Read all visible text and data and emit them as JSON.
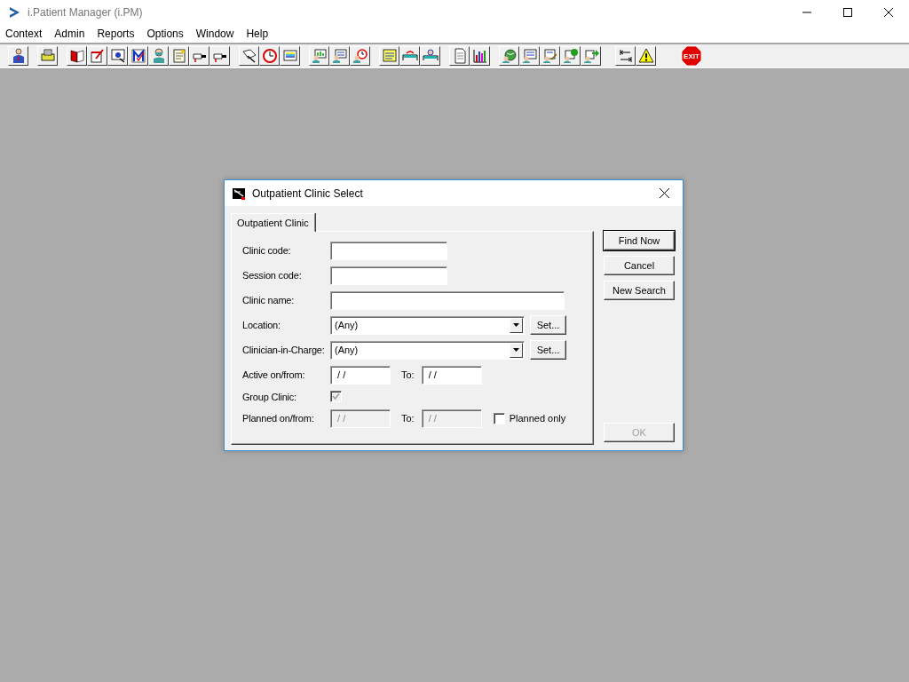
{
  "window": {
    "title": "i.Patient Manager (i.PM)"
  },
  "menu": [
    "Context",
    "Admin",
    "Reports",
    "Options",
    "Window",
    "Help"
  ],
  "toolbar": {
    "exit_label": "EXIT"
  },
  "dialog": {
    "title": "Outpatient Clinic Select",
    "tabs": [
      {
        "label": "Outpatient Clinic",
        "selected": true
      }
    ],
    "fields": [
      {
        "kind": "text",
        "label": "Clinic code:"
      },
      {
        "kind": "text",
        "label": "Session code:"
      },
      {
        "kind": "wide",
        "label": "Clinic name:"
      },
      {
        "kind": "combo",
        "label": "Location:",
        "value": "(Any)",
        "button": "Set..."
      },
      {
        "kind": "combo",
        "label": "Clinician-in-Charge:",
        "value": "(Any)",
        "button": "Set..."
      },
      {
        "kind": "dates",
        "label": "Active on/from:",
        "from": "/ /",
        "to_label": "To:",
        "to": "/ /",
        "disabled": false
      },
      {
        "kind": "check",
        "label": "Group Clinic:",
        "checked": true,
        "disabled": true
      },
      {
        "kind": "dates",
        "label": "Planned on/from:",
        "from": "/ /",
        "to_label": "To:",
        "to": "/ /",
        "disabled": true,
        "option": {
          "label": "Planned only",
          "checked": false
        }
      }
    ],
    "buttons": [
      {
        "label": "Find Now",
        "default": true,
        "disabled": false
      },
      {
        "label": "Cancel",
        "default": false,
        "disabled": false
      },
      {
        "label": "New Search",
        "default": false,
        "disabled": false
      }
    ],
    "ok_button": {
      "label": "OK",
      "default": false,
      "disabled": true
    }
  }
}
